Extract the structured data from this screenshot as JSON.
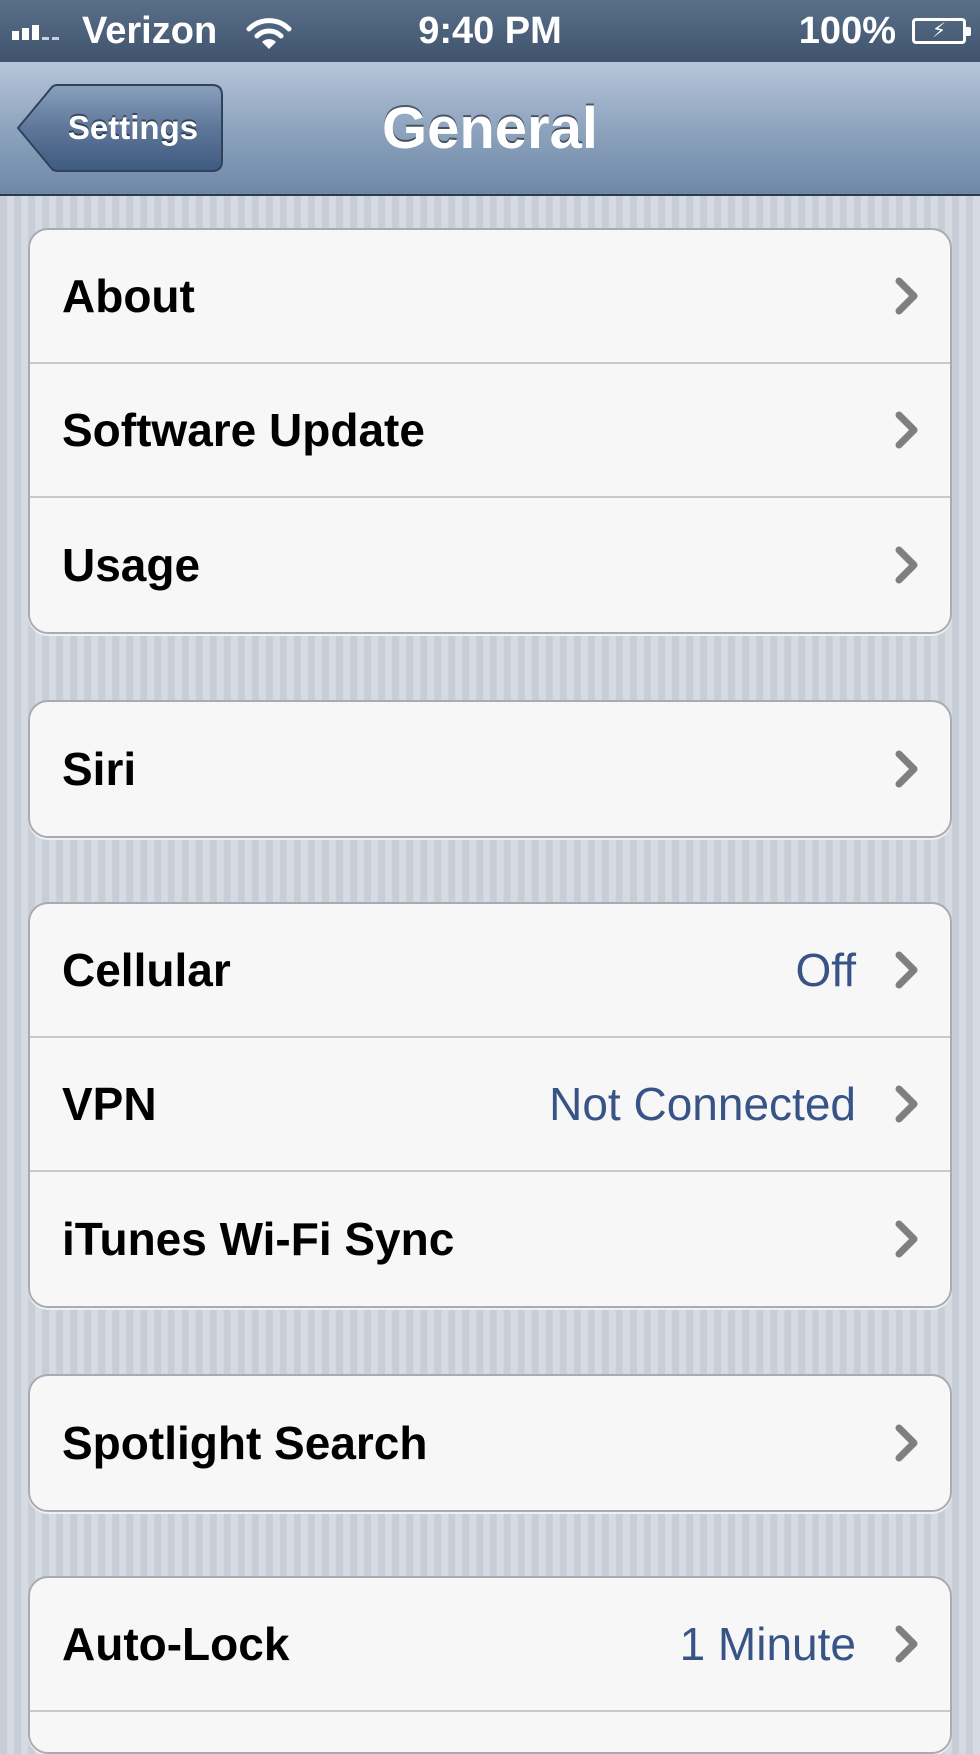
{
  "status_bar": {
    "carrier": "Verizon",
    "time": "9:40 PM",
    "battery_percent": "100%",
    "signal_bars": 3,
    "signal_bars_total": 5,
    "icons": [
      "signal-bars-icon",
      "wifi-icon",
      "battery-charging-icon"
    ]
  },
  "nav": {
    "back_label": "Settings",
    "title": "General"
  },
  "groups": [
    {
      "rows": [
        {
          "label": "About",
          "value": ""
        },
        {
          "label": "Software Update",
          "value": ""
        },
        {
          "label": "Usage",
          "value": ""
        }
      ]
    },
    {
      "rows": [
        {
          "label": "Siri",
          "value": ""
        }
      ]
    },
    {
      "rows": [
        {
          "label": "Cellular",
          "value": "Off"
        },
        {
          "label": "VPN",
          "value": "Not Connected"
        },
        {
          "label": "iTunes Wi-Fi Sync",
          "value": ""
        }
      ]
    },
    {
      "rows": [
        {
          "label": "Spotlight Search",
          "value": ""
        }
      ]
    },
    {
      "rows": [
        {
          "label": "Auto-Lock",
          "value": "1 Minute"
        }
      ]
    }
  ],
  "colors": {
    "value_text": "#385487",
    "nav_bar": "#8ea4be",
    "status_bar": "#4a5f79",
    "cell_background": "#f7f7f7"
  }
}
